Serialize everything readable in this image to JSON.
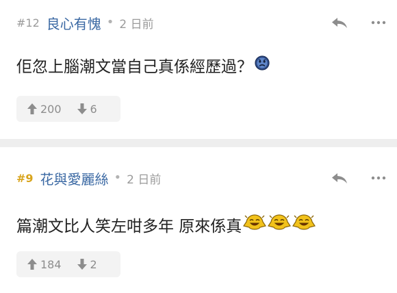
{
  "posts": [
    {
      "floor": "#12",
      "username": "良心有愧",
      "time": "2 日前",
      "content": "佢忽上腦潮文當自己真係經歷過？",
      "emojis": [
        "sad-face-icon"
      ],
      "upvotes": "200",
      "downvotes": "6",
      "is_op": false
    },
    {
      "floor": "#9",
      "username": "花與愛麗絲",
      "time": "2 日前",
      "content": "篇潮文比人笑左咁多年 原來係真",
      "emojis": [
        "laughing-face-icon",
        "laughing-face-icon",
        "laughing-face-icon"
      ],
      "upvotes": "184",
      "downvotes": "2",
      "is_op": true
    }
  ],
  "separator": "•",
  "colors": {
    "username": "#3a68a3",
    "op_floor": "#d8a41c",
    "meta": "#9b9b9b",
    "vote_bg": "#f3f3f3",
    "separator_bg": "#eeeeee"
  }
}
